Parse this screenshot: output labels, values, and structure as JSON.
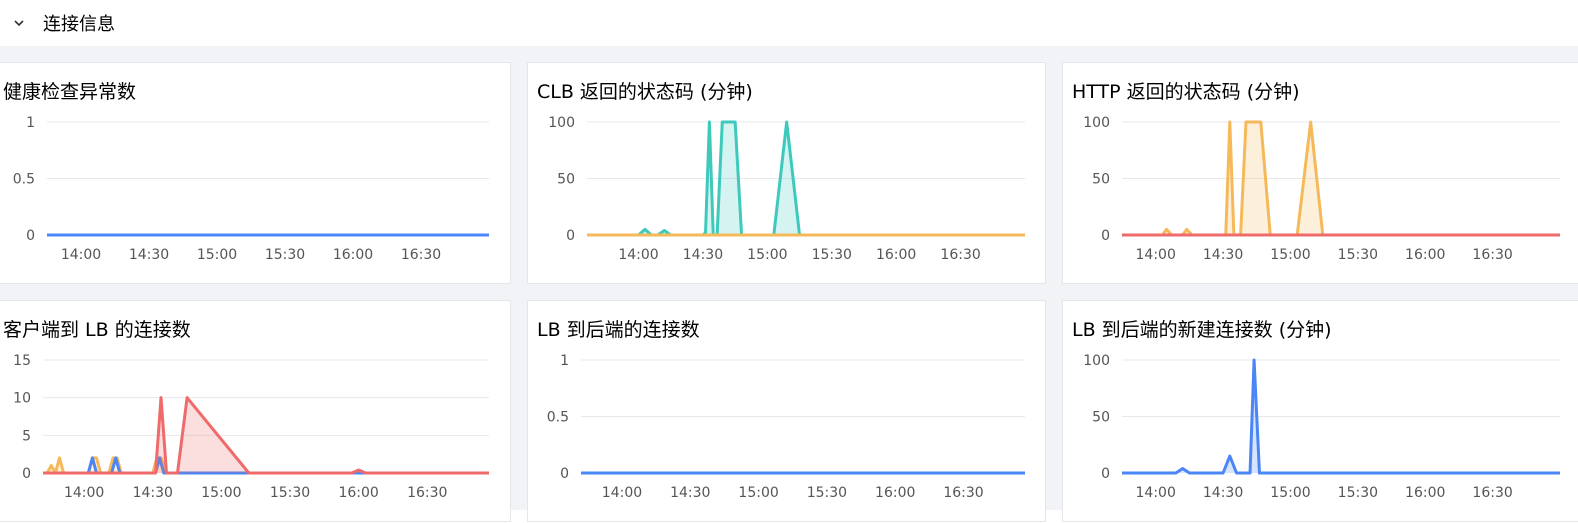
{
  "section": {
    "title": "连接信息",
    "icon": "chevron-down-icon"
  },
  "colors": {
    "blue": "#4a86f7",
    "teal": "#3ec9bd",
    "orange": "#f5b95a",
    "red": "#ef6b6b",
    "grid": "#e6e8ec",
    "axis_text": "#555555"
  },
  "x_ticks": [
    "14:00",
    "14:30",
    "15:00",
    "15:30",
    "16:00",
    "16:30"
  ],
  "chart_data": [
    {
      "id": "health",
      "type": "line",
      "title": "健康检查异常数",
      "y_ticks": [
        "1",
        "0.5",
        "0"
      ],
      "ylim": [
        0,
        1
      ],
      "xlim": [
        13.75,
        17.0
      ],
      "series": [
        {
          "color": "#4a86f7",
          "fill": false,
          "x": [
            13.75,
            17.0
          ],
          "values": [
            0,
            0
          ]
        }
      ]
    },
    {
      "id": "clb-status",
      "type": "area",
      "title": "CLB 返回的状态码 (分钟)",
      "y_ticks": [
        "100",
        "50",
        "0"
      ],
      "ylim": [
        0,
        100
      ],
      "xlim": [
        13.6,
        17.0
      ],
      "series": [
        {
          "color": "#3ec9bd",
          "fill": true,
          "x": [
            13.6,
            14.0,
            14.05,
            14.1,
            14.15,
            14.2,
            14.25,
            14.5,
            14.52,
            14.55,
            14.58,
            14.61,
            14.65,
            14.7,
            14.75,
            14.8,
            14.88,
            14.92,
            15.05,
            15.15,
            15.25,
            15.35,
            17.0
          ],
          "values": [
            0,
            0,
            5,
            0,
            0,
            4,
            0,
            0,
            2,
            100,
            0,
            0,
            100,
            100,
            100,
            0,
            0,
            0,
            0,
            100,
            0,
            0,
            0
          ]
        },
        {
          "color": "#f5b95a",
          "fill": false,
          "x": [
            13.6,
            17.0
          ],
          "values": [
            0,
            0
          ]
        }
      ]
    },
    {
      "id": "http-status",
      "type": "area",
      "title": "HTTP 返回的状态码 (分钟)",
      "y_ticks": [
        "100",
        "50",
        "0"
      ],
      "ylim": [
        0,
        100
      ],
      "xlim": [
        13.75,
        17.0
      ],
      "series": [
        {
          "color": "#f5b95a",
          "fill": true,
          "x": [
            13.75,
            14.05,
            14.08,
            14.12,
            14.2,
            14.23,
            14.27,
            14.52,
            14.55,
            14.58,
            14.63,
            14.67,
            14.72,
            14.78,
            14.85,
            15.05,
            15.15,
            15.24,
            17.0
          ],
          "values": [
            0,
            0,
            5,
            0,
            0,
            5,
            0,
            0,
            100,
            0,
            0,
            100,
            100,
            100,
            0,
            0,
            100,
            0,
            0
          ]
        },
        {
          "color": "#ef6b6b",
          "fill": false,
          "x": [
            13.75,
            17.0
          ],
          "values": [
            0,
            0
          ]
        }
      ]
    },
    {
      "id": "client-lb",
      "type": "area",
      "title": "客户端到 LB 的连接数",
      "y_ticks": [
        "15",
        "10",
        "5",
        "0"
      ],
      "ylim": [
        0,
        15
      ],
      "xlim": [
        13.7,
        16.95
      ],
      "series": [
        {
          "color": "#f5b95a",
          "fill": true,
          "x": [
            13.7,
            13.73,
            13.76,
            13.79,
            13.82,
            13.85,
            14.0,
            14.03,
            14.06,
            14.09,
            14.12,
            14.18,
            14.21,
            14.24,
            14.27,
            14.5,
            14.53,
            14.56,
            14.6,
            14.65,
            16.95
          ],
          "values": [
            0,
            0,
            1,
            0,
            2,
            0,
            0,
            0,
            2,
            2,
            0,
            0,
            2,
            2,
            0,
            0,
            2,
            2,
            0,
            0,
            0
          ]
        },
        {
          "color": "#4a86f7",
          "fill": false,
          "x": [
            13.7,
            14.03,
            14.06,
            14.09,
            14.2,
            14.23,
            14.26,
            14.52,
            14.55,
            14.58,
            16.95
          ],
          "values": [
            0,
            0,
            2,
            0,
            0,
            2,
            0,
            0,
            2,
            0,
            0
          ]
        },
        {
          "color": "#ef6b6b",
          "fill": true,
          "x": [
            13.7,
            14.48,
            14.52,
            14.56,
            14.6,
            14.68,
            14.75,
            15.2,
            15.95,
            16.0,
            16.05,
            16.95
          ],
          "values": [
            0,
            0,
            0,
            10,
            0,
            0,
            10,
            0,
            0,
            0.4,
            0,
            0
          ]
        }
      ]
    },
    {
      "id": "lb-backend",
      "type": "line",
      "title": "LB 到后端的连接数",
      "y_ticks": [
        "1",
        "0.5",
        "0"
      ],
      "ylim": [
        0,
        1
      ],
      "xlim": [
        13.7,
        16.95
      ],
      "series": [
        {
          "color": "#4a86f7",
          "fill": false,
          "x": [
            13.7,
            16.95
          ],
          "values": [
            0,
            0
          ]
        }
      ]
    },
    {
      "id": "lb-backend-new",
      "type": "area",
      "title": "LB 到后端的新建连接数 (分钟)",
      "y_ticks": [
        "100",
        "50",
        "0"
      ],
      "ylim": [
        0,
        100
      ],
      "xlim": [
        13.75,
        17.0
      ],
      "series": [
        {
          "color": "#4a86f7",
          "fill": true,
          "x": [
            13.75,
            14.15,
            14.2,
            14.25,
            14.5,
            14.55,
            14.6,
            14.7,
            14.73,
            14.77,
            14.8,
            17.0
          ],
          "values": [
            0,
            0,
            4,
            0,
            0,
            15,
            0,
            0,
            100,
            0,
            0,
            0
          ]
        }
      ]
    }
  ]
}
